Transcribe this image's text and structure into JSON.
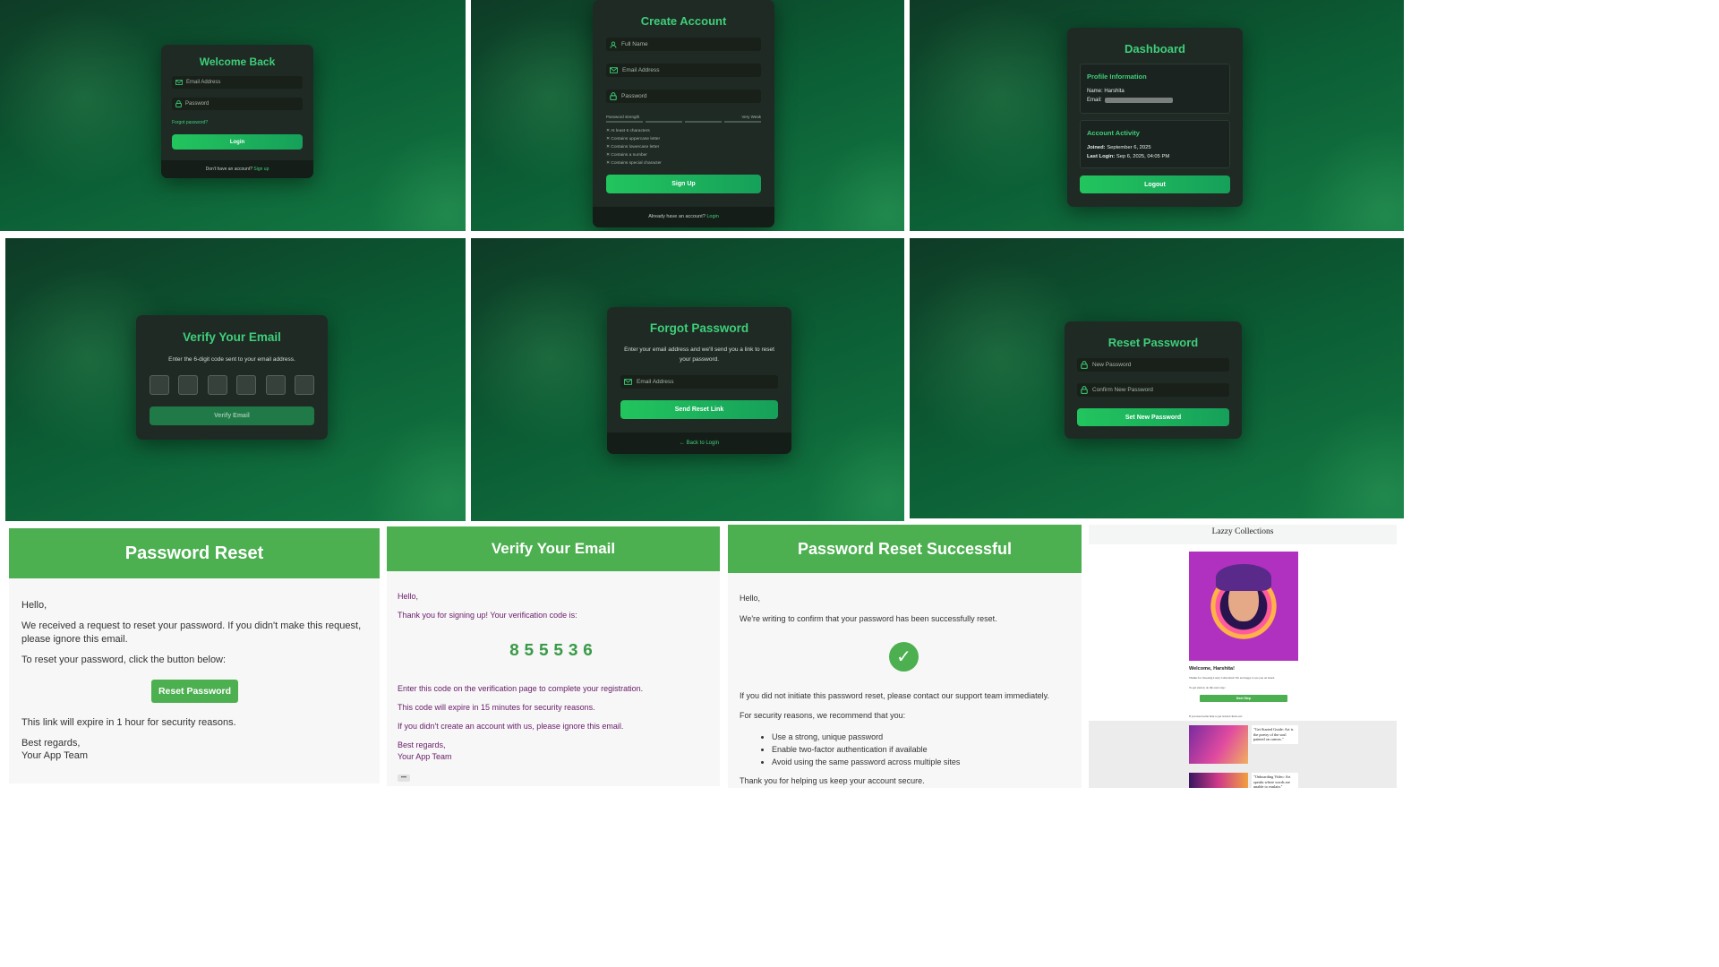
{
  "login": {
    "title": "Welcome Back",
    "email_placeholder": "Email Address",
    "password_placeholder": "Password",
    "forgot_link": "Forgot password?",
    "login_button": "Login",
    "footer_text": "Don't have an account?",
    "footer_link": "Sign up"
  },
  "signup": {
    "title": "Create Account",
    "name_placeholder": "Full Name",
    "email_placeholder": "Email Address",
    "password_placeholder": "Password",
    "strength_label": "Password strength",
    "strength_value": "Very Weak",
    "requirements": [
      "At least 6 characters",
      "Contains uppercase letter",
      "Contains lowercase letter",
      "Contains a number",
      "Contains special character"
    ],
    "signup_button": "Sign Up",
    "footer_text": "Already have an account?",
    "footer_link": "Login"
  },
  "dashboard": {
    "title": "Dashboard",
    "profile_heading": "Profile Information",
    "name_label": "Name:",
    "name_value": "Harshita",
    "email_label": "Email:",
    "activity_heading": "Account Activity",
    "joined_label": "Joined:",
    "joined_value": "September 6, 2025",
    "last_login_label": "Last Login:",
    "last_login_value": "Sep 6, 2025, 04:05 PM",
    "logout_button": "Logout"
  },
  "verify": {
    "title": "Verify Your Email",
    "subtitle": "Enter the 6-digit code sent to your email address.",
    "button": "Verify Email"
  },
  "forgot": {
    "title": "Forgot Password",
    "subtitle": "Enter your email address and we'll send you a link to reset your password.",
    "email_placeholder": "Email Address",
    "button": "Send Reset Link",
    "back_link": "Back to Login"
  },
  "reset": {
    "title": "Reset Password",
    "new_placeholder": "New Password",
    "confirm_placeholder": "Confirm New Password",
    "button": "Set New Password"
  },
  "email_reset": {
    "header": "Password Reset",
    "greeting": "Hello,",
    "p1": "We received a request to reset your password. If you didn't make this request, please ignore this email.",
    "p2": "To reset your password, click the button below:",
    "button": "Reset Password",
    "p3": "This link will expire in 1 hour for security reasons.",
    "signoff1": "Best regards,",
    "signoff2": "Your App Team"
  },
  "email_verify": {
    "header": "Verify Your Email",
    "greeting": "Hello,",
    "p1": "Thank you for signing up! Your verification code is:",
    "code": "855536",
    "p2": "Enter this code on the verification page to complete your registration.",
    "p3": "This code will expire in 15 minutes for security reasons.",
    "p4": "If you didn't create an account with us, please ignore this email.",
    "signoff1": "Best regards,",
    "signoff2": "Your App Team",
    "more": "•••"
  },
  "email_success": {
    "header": "Password Reset Successful",
    "greeting": "Hello,",
    "p1": "We're writing to confirm that your password has been successfully reset.",
    "check": "✓",
    "p2": "If you did not initiate this password reset, please contact our support team immediately.",
    "p3": "For security reasons, we recommend that you:",
    "bullets": [
      "Use a strong, unique password",
      "Enable two-factor authentication if available",
      "Avoid using the same password across multiple sites"
    ],
    "p4": "Thank you for helping us keep your account secure."
  },
  "newsletter": {
    "brand": "Lazzy Collections",
    "welcome": "Welcome, Harshita!",
    "intro": "Thanks for choosing Lazzy Collections! We are happy to see you on board.",
    "next": "To get started, do this next step:",
    "button": "Next Step",
    "help": "If you need some help to get started check out:",
    "quote1": "\"Get Started Guide: Art is the poetry of the soul painted on canvas.\"",
    "quote2": "\"Onboarding Video: Art speaks where words are unable to explain.\""
  },
  "colors": {
    "accent": "#22c55e",
    "card": "#1f2a25",
    "email_header": "#4caf50",
    "email_purple": "#6a1b6a"
  }
}
